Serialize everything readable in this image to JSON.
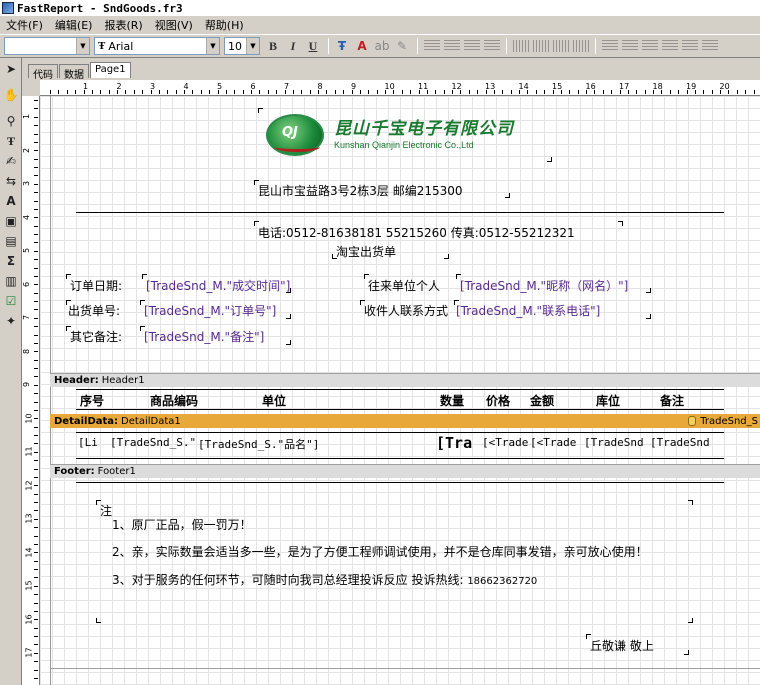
{
  "window": {
    "title": "FastReport - SndGoods.fr3"
  },
  "menu": [
    "文件(F)",
    "编辑(E)",
    "报表(R)",
    "视图(V)",
    "帮助(H)"
  ],
  "toolbar": {
    "style_value": "",
    "font_value": "Arial",
    "size_value": "10"
  },
  "tabs": [
    "代码",
    "数据",
    "Page1"
  ],
  "ruler": {
    "h": [
      "1",
      "2",
      "3",
      "4",
      "5",
      "6",
      "7",
      "8",
      "9",
      "10",
      "11",
      "12",
      "13",
      "14",
      "15",
      "16",
      "17",
      "18",
      "19",
      "20"
    ],
    "v": [
      "1",
      "2",
      "3",
      "4",
      "5",
      "6",
      "7",
      "8",
      "9",
      "10",
      "11",
      "12",
      "13",
      "14",
      "15",
      "16",
      "17"
    ]
  },
  "logo": {
    "cn": "昆山千宝电子有限公司",
    "en": "Kunshan Qianjin Electronic Co.,Ltd",
    "mark": "QJ"
  },
  "report": {
    "address": "昆山市宝益路3号2栋3层    邮编215300",
    "phone": "电话:0512-81638181 55215260  传真:0512-55212321",
    "title": "淘宝出货单",
    "order_date_label": "订单日期:",
    "order_date_field": "[TradeSnd_M.\"成交时间\"]",
    "unit_label": "往来单位个人",
    "unit_field": "[TradeSnd_M.\"昵称（网名）\"]",
    "ship_no_label": "出货单号:",
    "ship_no_field": "[TradeSnd_M.\"订单号\"]",
    "contact_label": "收件人联系方式",
    "contact_field": "[TradeSnd_M.\"联系电话\"]",
    "other_label": "其它备注:",
    "other_field": "[TradeSnd_M.\"备注\"]"
  },
  "bands": {
    "header": {
      "type": "Header:",
      "name": "Header1"
    },
    "detail": {
      "type": "DetailData:",
      "name": "DetailData1",
      "source": "TradeSnd_S"
    },
    "footer": {
      "type": "Footer:",
      "name": "Footer1"
    }
  },
  "columns": [
    "序号",
    "商品编码",
    "单位",
    "数量",
    "价格",
    "金额",
    "库位",
    "备注"
  ],
  "detail_cells": [
    "[Li",
    "[TradeSnd_S.\"",
    "[TradeSnd_S.\"品名\"]",
    "[Tra",
    "[<Trade",
    "[<Trade",
    "[TradeSnd",
    "[TradeSnd"
  ],
  "notes": {
    "heading": "注",
    "items": [
      "1、原厂正品，假一罚万！",
      "2、亲，实际数量会适当多一些，是为了方便工程师调试使用，并不是仓库同事发错，亲可放心使用！",
      "3、对于服务的任何环节，可随时向我司总经理投诉反应 投诉热线:  "
    ],
    "hotline": "18662362720",
    "signature": "丘敬谦 敬上"
  }
}
